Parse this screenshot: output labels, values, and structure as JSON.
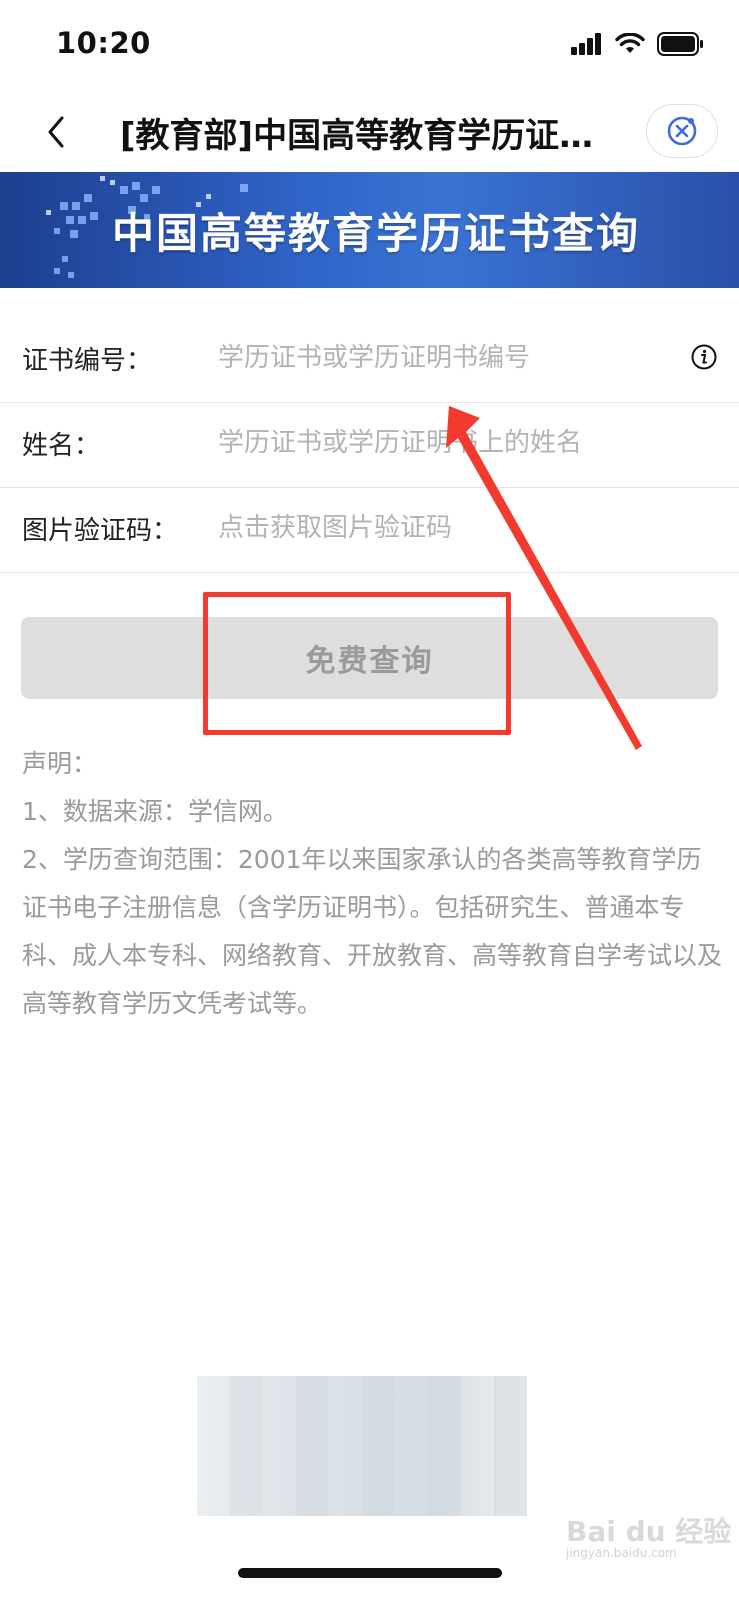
{
  "status_bar": {
    "time": "10:20"
  },
  "nav": {
    "title": "[教育部]中国高等教育学历证书查询"
  },
  "banner": {
    "title": "中国高等教育学历证书查询"
  },
  "form": {
    "fields": [
      {
        "label": "证书编号：",
        "placeholder": "学历证书或学历证明书编号",
        "value": ""
      },
      {
        "label": "姓名：",
        "placeholder": "学历证书或学历证明书上的姓名",
        "value": ""
      },
      {
        "label": "图片验证码：",
        "placeholder": "点击获取图片验证码",
        "value": ""
      }
    ],
    "submit_label": "免费查询"
  },
  "notice": {
    "heading": "声明：",
    "items": [
      "1、数据来源：学信网。",
      "2、学历查询范围：2001年以来国家承认的各类高等教育学历证书电子注册信息（含学历证明书）。包括研究生、普通本专科、成人本专科、网络教育、开放教育、高等教育自学考试以及高等教育学历文凭考试等。"
    ]
  },
  "watermark": {
    "brand": "Bai du 经验",
    "url": "jingyan.baidu.com"
  },
  "annotation_color": "#f23a2e"
}
